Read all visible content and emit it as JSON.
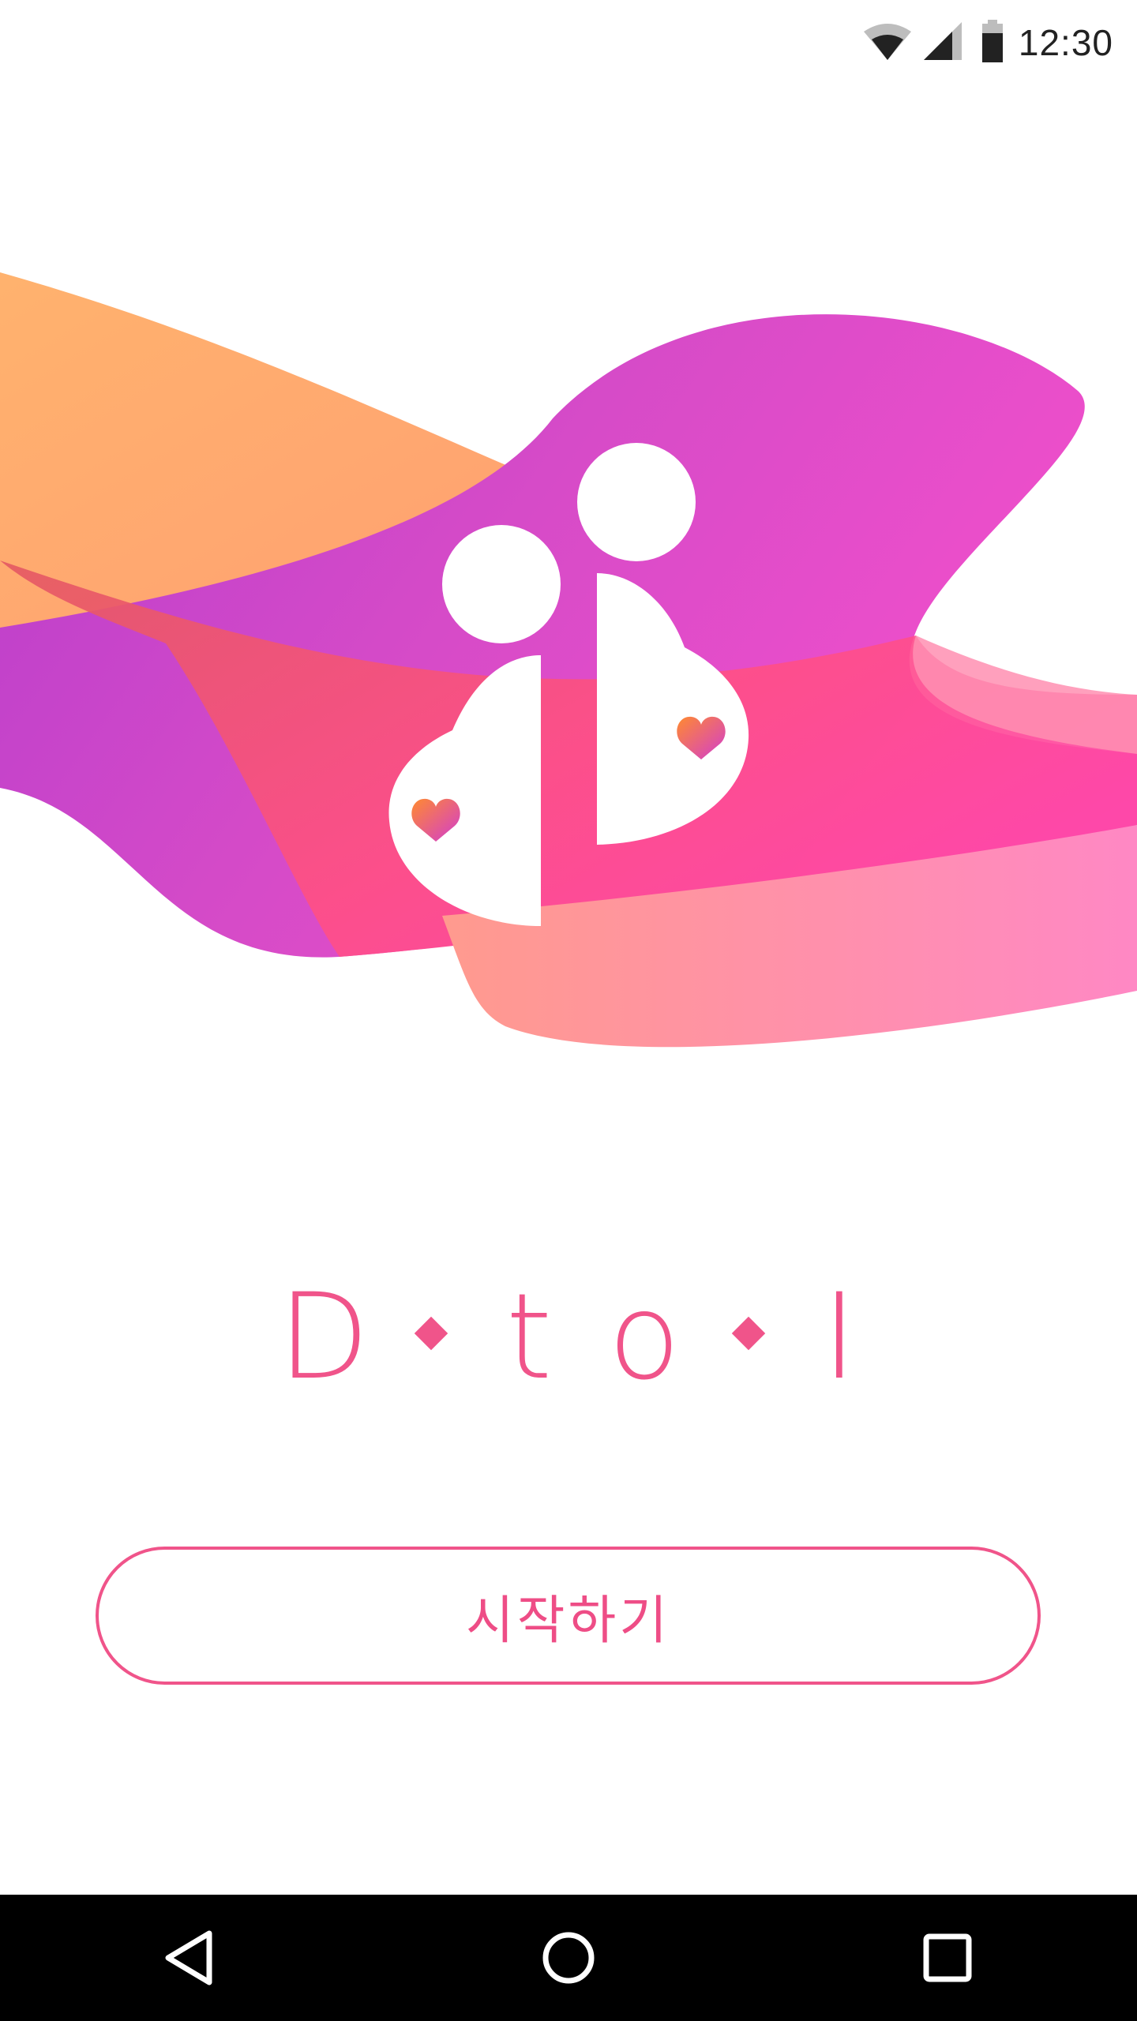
{
  "status_bar": {
    "time": "12:30",
    "icons": [
      "wifi-icon",
      "signal-icon",
      "battery-icon"
    ]
  },
  "brand": {
    "wordmark": "D·to·I",
    "wordmark_glyphs": [
      "D",
      "t",
      "o",
      "I"
    ],
    "colors": {
      "pink": "#f0548a",
      "orange": "#ffa866",
      "purple": "#b53fd0",
      "magenta": "#ff47a6"
    }
  },
  "start_button": {
    "label": "시작하기"
  },
  "nav_bar": {
    "buttons": [
      "back-icon",
      "home-icon",
      "recents-icon"
    ]
  }
}
